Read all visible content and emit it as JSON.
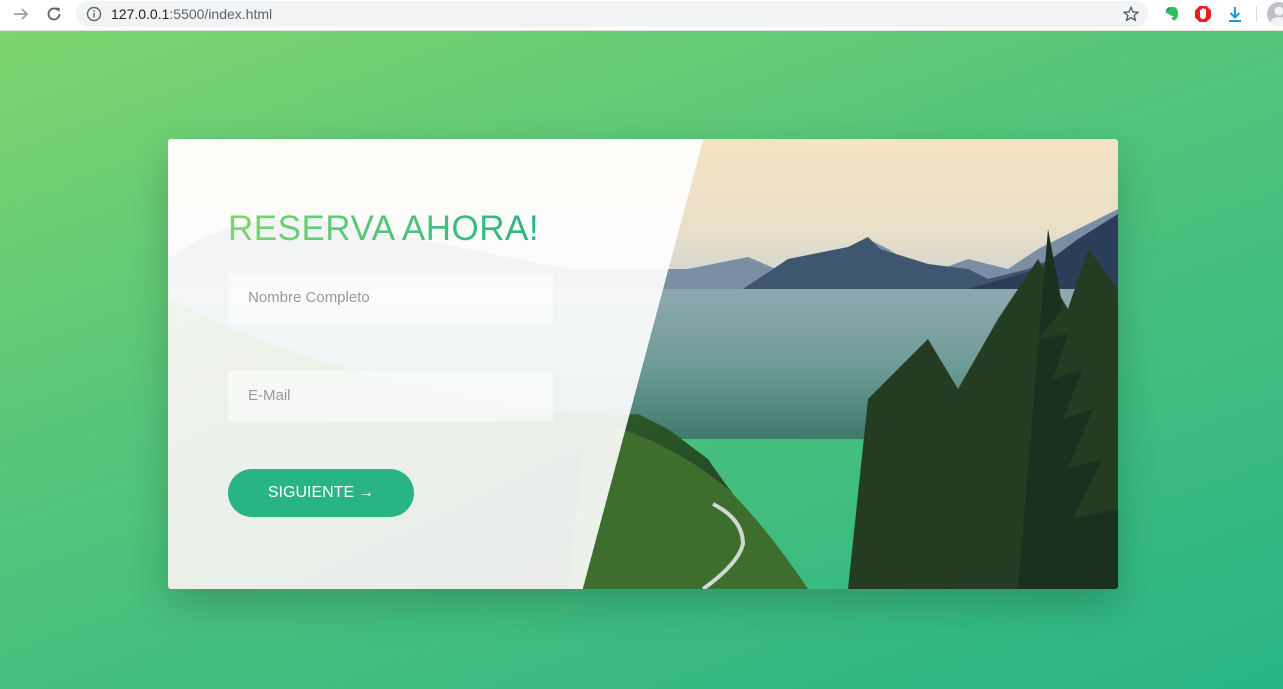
{
  "browser": {
    "url_host": "127.0.0.1",
    "url_rest": ":5500/index.html"
  },
  "form": {
    "heading": "RESERVA AHORA!",
    "name_placeholder": "Nombre Completo",
    "email_placeholder": "E-Mail",
    "submit_label": "SIGUIENTE",
    "submit_arrow": "→"
  },
  "colors": {
    "gradient_light": "#7ed56f",
    "gradient_mid": "#55c57a",
    "gradient_dark": "#28b485",
    "button": "#28b485"
  },
  "icons": [
    "forward-arrow-icon",
    "reload-icon",
    "info-icon",
    "star-icon",
    "evernote-icon",
    "adblock-icon",
    "download-icon",
    "avatar-icon"
  ]
}
